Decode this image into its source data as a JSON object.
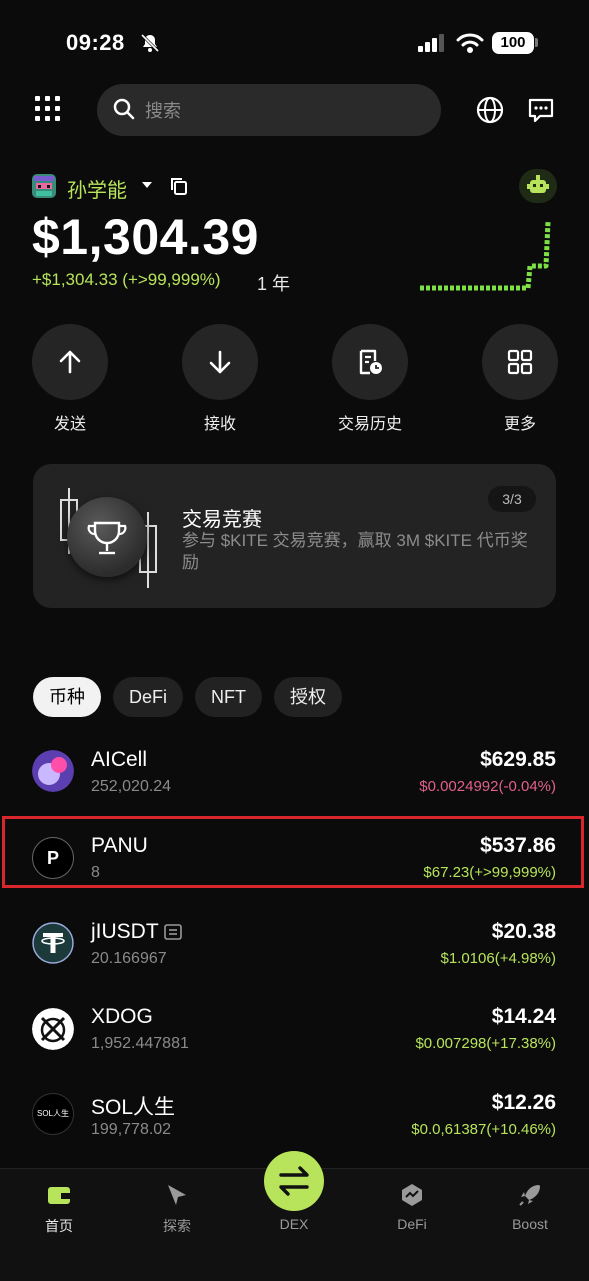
{
  "status_bar": {
    "time": "09:28",
    "battery": "100"
  },
  "search": {
    "placeholder": "搜索"
  },
  "wallet": {
    "name": "孙学能",
    "balance": "$1,304.39",
    "change": "+$1,304.33 (+>99,999%)",
    "period": "1 年"
  },
  "actions": [
    {
      "label": "发送",
      "icon": "arrow-up-icon"
    },
    {
      "label": "接收",
      "icon": "arrow-down-icon"
    },
    {
      "label": "交易历史",
      "icon": "history-icon"
    },
    {
      "label": "更多",
      "icon": "grid-icon"
    }
  ],
  "banner": {
    "title": "交易竞赛",
    "description": "参与 $KITE 交易竞赛，赢取 3M $KITE 代币奖励",
    "page": "3/3"
  },
  "tabs": [
    "币种",
    "DeFi",
    "NFT",
    "授权"
  ],
  "tokens": [
    {
      "name": "AICell",
      "amount": "252,020.24",
      "value": "$629.85",
      "change": "$0.0024992(-0.04%)",
      "trend": "down"
    },
    {
      "name": "PANU",
      "amount": "8",
      "value": "$537.86",
      "change": "$67.23(+>99,999%)",
      "trend": "up",
      "icon_letter": "P"
    },
    {
      "name": "jIUSDT",
      "amount": "20.166967",
      "value": "$20.38",
      "change": "$1.0106(+4.98%)",
      "trend": "up"
    },
    {
      "name": "XDOG",
      "amount": "1,952.447881",
      "value": "$14.24",
      "change": "$0.007298(+17.38%)",
      "trend": "up"
    },
    {
      "name": "SOL人生",
      "amount": "199,778.02",
      "value": "$12.26",
      "change": "$0.0,61387(+10.46%)",
      "trend": "up",
      "icon_text": "SOL人生"
    }
  ],
  "bottom_nav": [
    {
      "label": "首页",
      "icon": "wallet-icon",
      "active": true
    },
    {
      "label": "探索",
      "icon": "compass-icon"
    },
    {
      "label": "DEX",
      "icon": "swap-icon"
    },
    {
      "label": "DeFi",
      "icon": "defi-icon"
    },
    {
      "label": "Boost",
      "icon": "rocket-icon"
    }
  ],
  "colors": {
    "accent": "#b7e45a",
    "down": "#e0608a",
    "highlight": "#d8262c",
    "background": "#0b0b0b"
  }
}
